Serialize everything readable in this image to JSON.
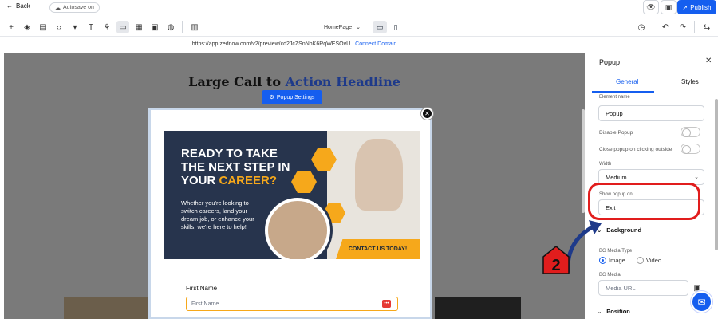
{
  "topbar": {
    "back_label": "Back",
    "autosave_label": "Autosave on",
    "publish_label": "Publish"
  },
  "toolbar": {
    "page_selected": "HomePage"
  },
  "urlbar": {
    "url": "https://app.zednow.com/v2/preview/cd2JcZSnNhK6RqWESOvU",
    "connect_domain": "Connect Domain"
  },
  "canvas": {
    "headline_main": "Large Call to ",
    "headline_accent": "Action Headline",
    "popup_settings_label": "Popup Settings"
  },
  "popup": {
    "banner_title_1": "READY TO TAKE",
    "banner_title_2": "THE NEXT STEP IN",
    "banner_title_3a": "YOUR ",
    "banner_title_3b": "CAREER?",
    "banner_body": "Whether you're looking to switch careers, land your dream job, or enhance your skills, we're here to help!",
    "cta_label": "CONTACT US TODAY!",
    "first_name_label": "First Name",
    "first_name_placeholder": "First Name"
  },
  "panel": {
    "title": "Popup",
    "tabs": [
      "General",
      "Styles"
    ],
    "element_name_label": "Element name",
    "element_name_value": "Popup",
    "disable_popup_label": "Disable Popup",
    "close_outside_label": "Close popup on clicking outside",
    "width_label": "Width",
    "width_value": "Medium",
    "show_popup_on_label": "Show popup on",
    "show_popup_on_value": "Exit",
    "background_header": "Background",
    "bg_media_type_label": "BG Media Type",
    "media_type_options": [
      "Image",
      "Video"
    ],
    "media_type_selected": "Image",
    "bg_media_label": "BG Media",
    "media_url_placeholder": "Media URL",
    "position_header": "Position"
  },
  "annotation": {
    "step_number": "2",
    "ring_color": "#e11d1d",
    "arrow_color": "#1e3a8a"
  },
  "colors": {
    "accent": "#155eef",
    "banner_orange": "#f6a81b",
    "banner_navy": "#27344d"
  }
}
